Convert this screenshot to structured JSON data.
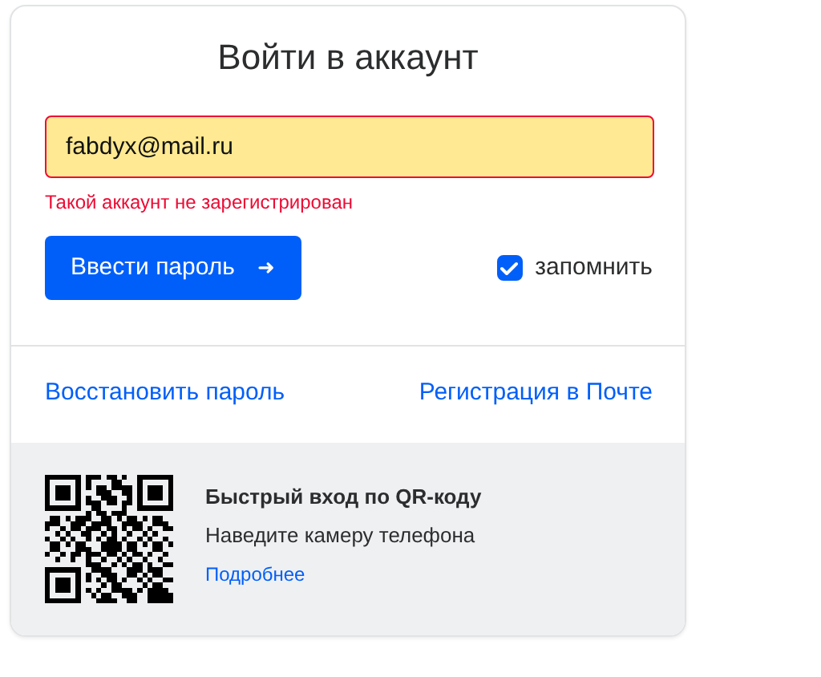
{
  "title": "Войти в аккаунт",
  "email_field": {
    "value": "fabdyx@mail.ru",
    "invalid": true
  },
  "error": "Такой аккаунт не зарегистрирован",
  "submit_button": {
    "label": "Ввести пароль",
    "icon": "➜"
  },
  "remember": {
    "label": "запомнить",
    "checked": true
  },
  "links": [
    "Восстановить пароль",
    "Регистрация в Почте"
  ],
  "qr_login": {
    "title": "Быстрый вход по QR-коду",
    "hint": "Наведите камеру телефона",
    "link": "Подробнее"
  }
}
